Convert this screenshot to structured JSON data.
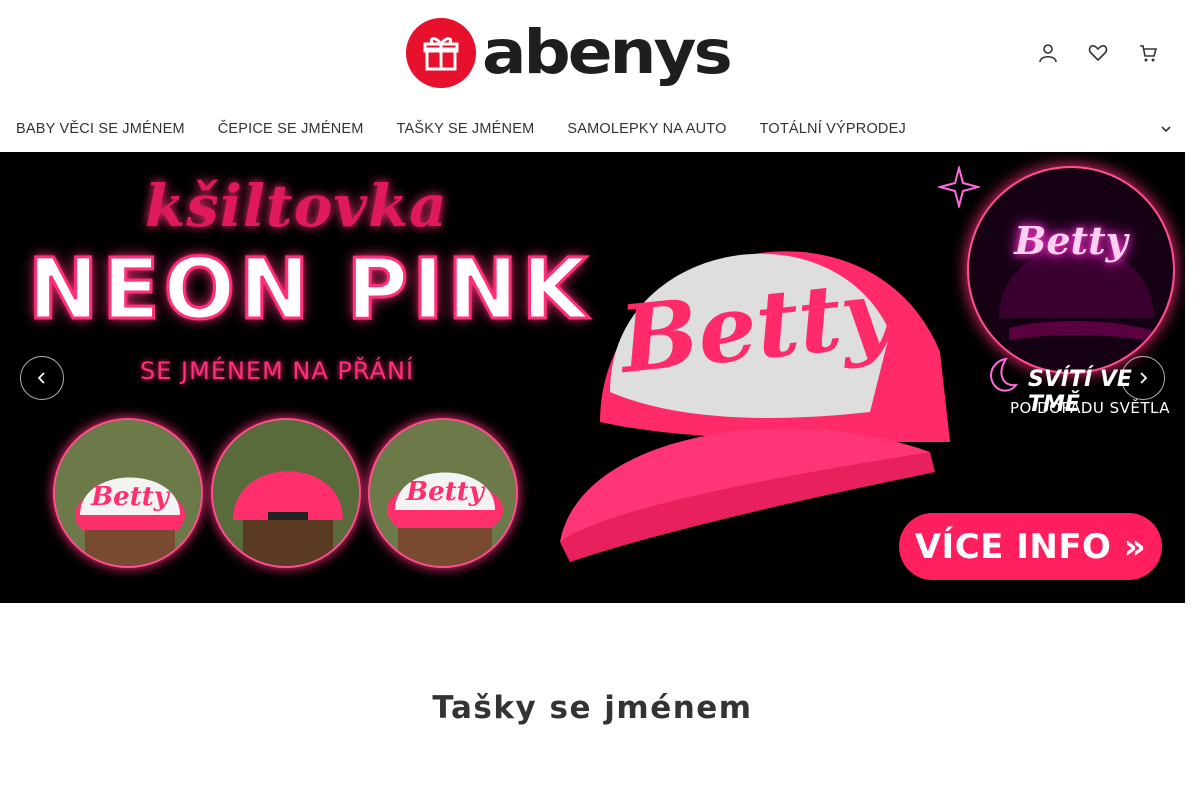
{
  "brand": {
    "name": "abenys",
    "badge_color": "#e8112d"
  },
  "header": {
    "icons": [
      "user-icon",
      "heart-icon",
      "cart-icon"
    ]
  },
  "nav": {
    "items": [
      {
        "label": "BABY VĚCI SE JMÉNEM"
      },
      {
        "label": "ČEPICE SE JMÉNEM"
      },
      {
        "label": "TAŠKY SE JMÉNEM"
      },
      {
        "label": "SAMOLEPKY NA AUTO"
      },
      {
        "label": "TOTÁLNÍ VÝPRODEJ"
      }
    ],
    "more_icon": "chevron-down-icon"
  },
  "banner": {
    "small_title": "kšiltovka",
    "big_title": "NEON PINK",
    "subtitle": "SE JMÉNEM NA PŘÁNÍ",
    "cap_name": "Betty",
    "glow_name": "Betty",
    "glow_title": "SVÍTÍ VE TMĚ",
    "glow_sub": "PO DOPADU SVĚTLA",
    "cta": "VÍCE INFO »",
    "accent_color": "#ff1f5f"
  },
  "section": {
    "title": "Tašky se jménem"
  }
}
